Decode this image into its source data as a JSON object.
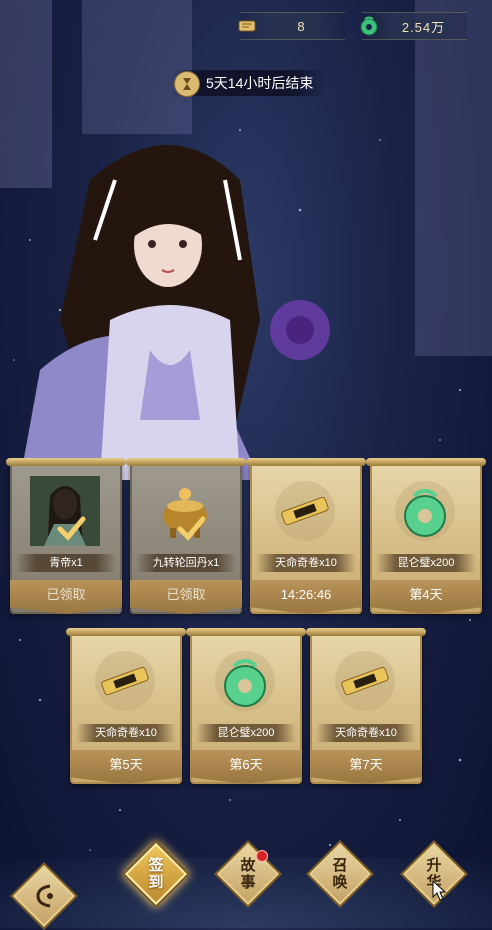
{
  "currency": {
    "ticket": {
      "icon": "scroll-ticket-icon",
      "value": "8"
    },
    "jade": {
      "icon": "jade-disc-icon",
      "value": "2.54万"
    }
  },
  "timer": {
    "icon": "hourglass-icon",
    "text": "5天14小时后结束"
  },
  "rewards": [
    {
      "name": "青帝x1",
      "status": "已领取",
      "claimed": true,
      "icon": "hero-portrait-icon"
    },
    {
      "name": "九转轮回丹x1",
      "status": "已领取",
      "claimed": true,
      "icon": "elixir-cauldron-icon"
    },
    {
      "name": "天命奇卷x10",
      "status": "14:26:46",
      "claimed": false,
      "icon": "golden-scroll-icon"
    },
    {
      "name": "昆仑璧x200",
      "status": "第4天",
      "claimed": false,
      "icon": "jade-disc-icon"
    },
    {
      "name": "天命奇卷x10",
      "status": "第5天",
      "claimed": false,
      "icon": "golden-scroll-icon"
    },
    {
      "name": "昆仑璧x200",
      "status": "第6天",
      "claimed": false,
      "icon": "jade-disc-icon"
    },
    {
      "name": "天命奇卷x10",
      "status": "第7天",
      "claimed": false,
      "icon": "golden-scroll-icon"
    }
  ],
  "nav": {
    "sign_in": "签到",
    "story": "故事",
    "summon": "召唤",
    "upgrade": "升华"
  },
  "colors": {
    "gold": "#d4bb84",
    "night": "#1a2246",
    "badge_red": "#d62424"
  }
}
